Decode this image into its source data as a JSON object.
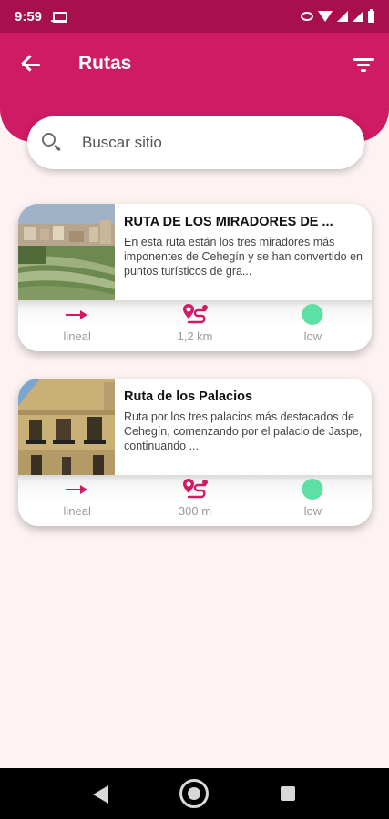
{
  "status_bar": {
    "time": "9:59"
  },
  "app_bar": {
    "title": "Rutas",
    "accent": "#cf1a64"
  },
  "search": {
    "placeholder": "Buscar sitio"
  },
  "routes": [
    {
      "title": "RUTA DE LOS MIRADORES DE ...",
      "description": "En esta ruta están los tres miradores más imponentes de Cehegín y se han convertido en puntos turísticos de gra...",
      "type": "lineal",
      "distance": "1,2 km",
      "difficulty": "low"
    },
    {
      "title": "Ruta de los Palacios",
      "description": "Ruta por los tres palacios más destacados de Cehegín, comenzando por el palacio de Jaspe, continuando ...",
      "type": "lineal",
      "distance": "300 m",
      "difficulty": "low"
    }
  ],
  "colors": {
    "level_low": "#5de0a3",
    "status_bar": "#a80f4c"
  }
}
